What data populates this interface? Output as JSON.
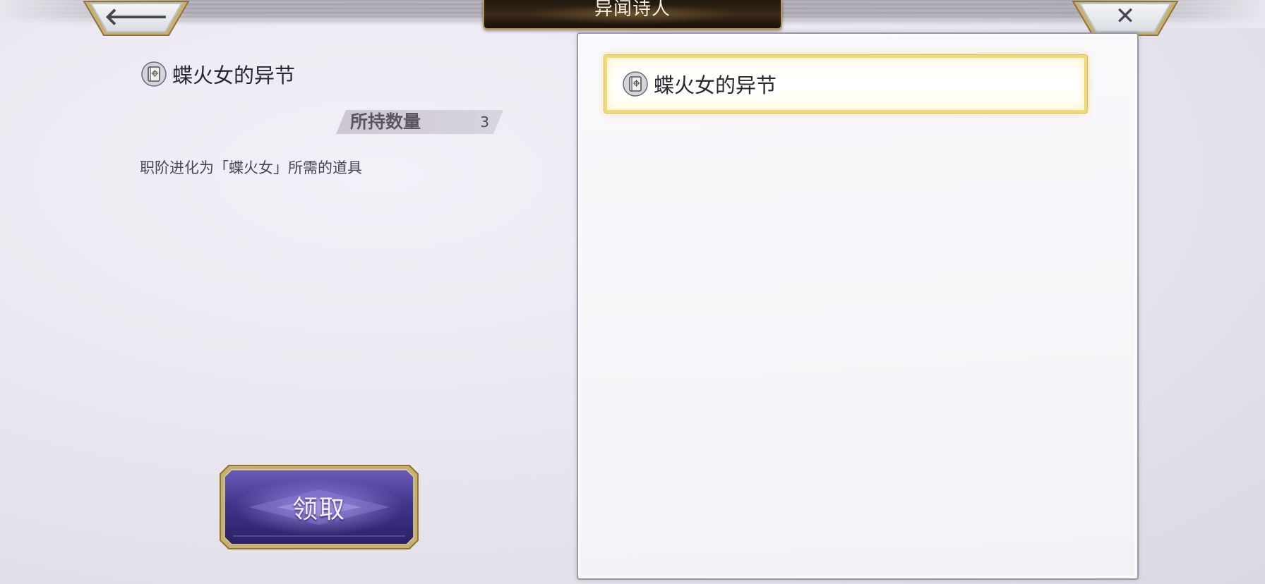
{
  "header": {
    "title": "异闻诗人",
    "back_icon": "arrow-left-icon",
    "close_icon": "close-icon"
  },
  "item_detail": {
    "name": "蝶火女的异节",
    "icon": "book-icon",
    "quantity_label": "所持数量",
    "quantity_value": "3",
    "description": "职阶进化为「蝶火女」所需的道具",
    "claim_button_label": "领取"
  },
  "item_list": {
    "items": [
      {
        "name": "蝶火女的异节",
        "icon": "book-icon",
        "selected": true
      }
    ]
  },
  "colors": {
    "selected_border": "#f0d978",
    "title_plate": "#2b1f12",
    "claim_button": "#4b3f8c"
  }
}
